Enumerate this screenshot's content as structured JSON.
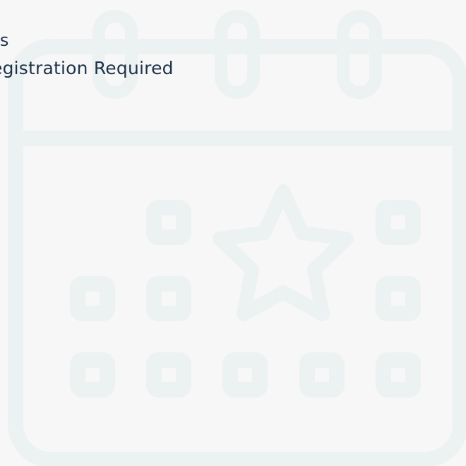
{
  "background_icon": {
    "name": "calendar-star-icon",
    "color": "#ecf2f1"
  },
  "header": {
    "line1": "ons",
    "line2": "egistration Required"
  },
  "colors": {
    "background": "#f7f7f7",
    "text": "#1f3349"
  }
}
